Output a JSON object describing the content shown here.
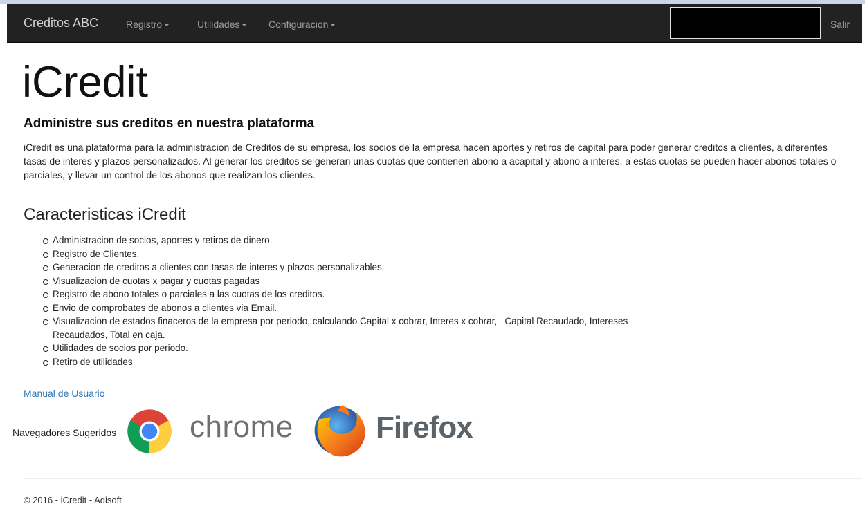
{
  "navbar": {
    "brand": "Creditos ABC",
    "menus": [
      {
        "label": "Registro"
      },
      {
        "label": "Utilidades"
      },
      {
        "label": "Configuracion"
      }
    ],
    "logout_label": "Salir",
    "colors": {
      "background": "#222222",
      "text": "#9d9d9d",
      "brand": "#d2d2d2"
    }
  },
  "hero": {
    "title": "iCredit",
    "subtitle": "Administre sus creditos en nuestra plataforma",
    "description": "iCredit es una plataforma para la administracion de Creditos de su empresa, los socios de la empresa hacen aportes y retiros de capital para poder generar creditos a clientes, a diferentes tasas de interes y plazos personalizados. Al generar los creditos se generan unas cuotas que contienen abono a acapital y abono a interes, a estas cuotas se pueden hacer abonos totales o parciales, y llevar un control de los abonos que realizan los clientes."
  },
  "features": {
    "title": "Caracteristicas iCredit",
    "items": [
      "Administracion de socios, aportes y retiros de dinero.",
      "Registro de Clientes.",
      "Generacion de creditos a clientes con tasas de interes y plazos personalizables.",
      "Visualizacion de cuotas x pagar y cuotas pagadas",
      "Registro de abono totales o parciales a las cuotas de los creditos.",
      "Envio de comprobates de abonos a clientes via Email.",
      "Visualizacion de estados finaceros de la empresa por periodo, calculando Capital x cobrar, Interes x cobrar,   Capital Recaudado, Intereses Recaudados, Total en caja.",
      "Utilidades de socios por periodo.",
      "Retiro de utilidades"
    ]
  },
  "links": {
    "manual": "Manual de Usuario",
    "link_color": "#337ab7"
  },
  "browsers": {
    "label": "Navegadores Sugeridos",
    "chrome_word": "chrome",
    "firefox_word": "Firefox",
    "icons": [
      "chrome-logo-icon",
      "firefox-logo-icon"
    ]
  },
  "footer": {
    "text": "© 2016 - iCredit - Adisoft"
  }
}
